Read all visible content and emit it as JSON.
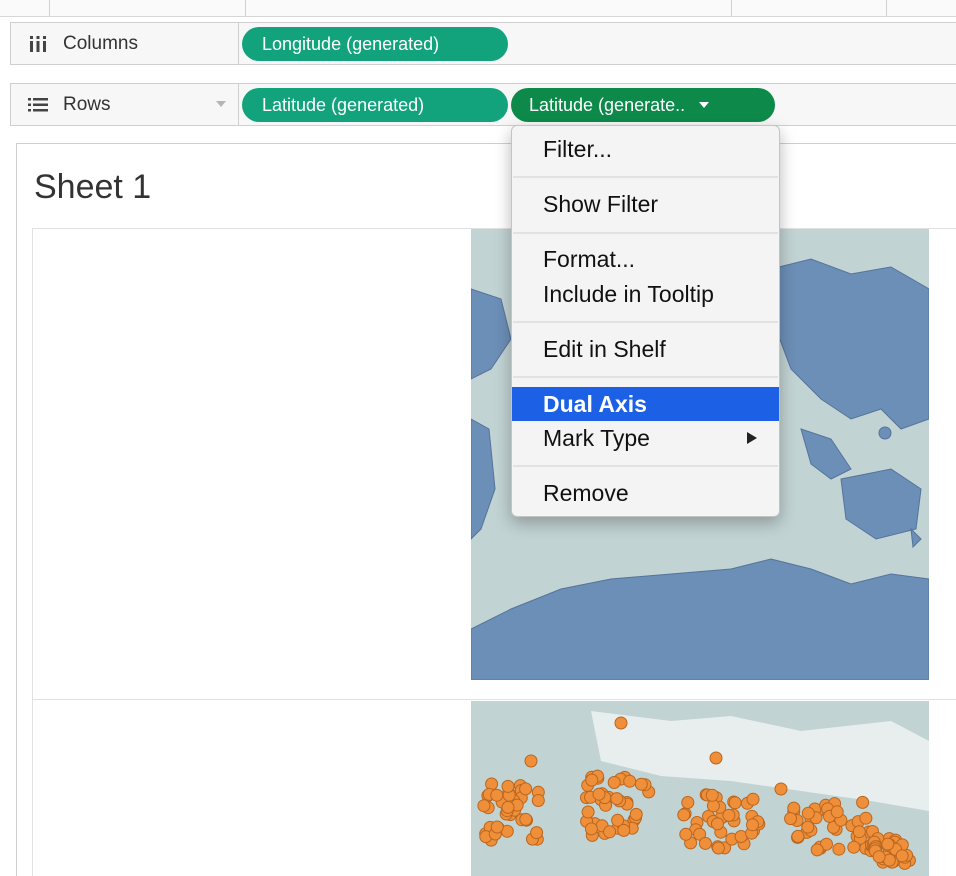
{
  "shelves": {
    "columns": {
      "label": "Columns",
      "icon": "columns-shelf-icon",
      "pills": [
        "Longitude (generated)"
      ]
    },
    "rows": {
      "label": "Rows",
      "icon": "rows-shelf-icon",
      "pills": [
        "Latitude (generated)",
        "Latitude (generate.."
      ]
    }
  },
  "sheet": {
    "title": "Sheet 1"
  },
  "context_menu": {
    "items": [
      "Filter...",
      "Show Filter",
      "Format...",
      "Include in Tooltip",
      "Edit in Shelf",
      "Dual Axis",
      "Mark Type",
      "Remove"
    ],
    "highlighted": "Dual Axis"
  },
  "colors": {
    "pill_green": "#12a37d",
    "pill_active": "#0d8a4a",
    "menu_highlight": "#1c61e5",
    "map_land": "#6c8fb7",
    "map_water": "#c2d3d3",
    "mark_orange": "#ef8f3a"
  }
}
